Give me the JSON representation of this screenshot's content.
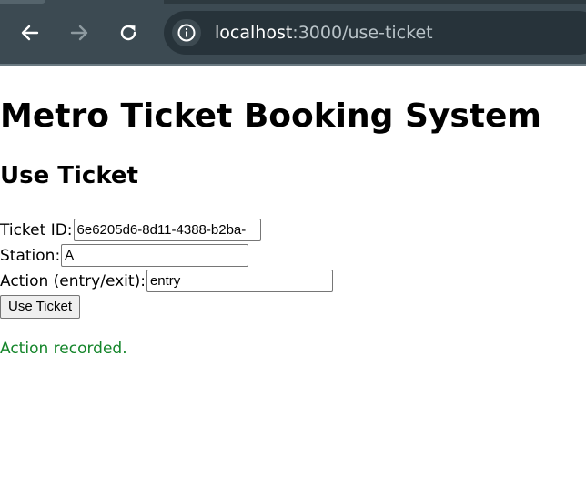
{
  "browser": {
    "url_host": "localhost",
    "url_path": ":3000/use-ticket",
    "icons": {
      "back": "arrow-left-icon",
      "forward": "arrow-right-icon",
      "reload": "reload-icon",
      "site_info": "info-icon"
    },
    "colors": {
      "toolbar_bg": "#3c4a52",
      "omnibox_bg": "#27333a"
    }
  },
  "page": {
    "title": "Metro Ticket Booking System",
    "section_title": "Use Ticket",
    "form": {
      "ticket_id_label": "Ticket ID:",
      "ticket_id_value": "6e6205d6-8d11-4388-b2ba-",
      "station_label": "Station:",
      "station_value": "A",
      "action_label": "Action (entry/exit):",
      "action_value": "entry",
      "submit_label": "Use Ticket"
    },
    "status_message": "Action recorded.",
    "status_color": "#14852a"
  }
}
